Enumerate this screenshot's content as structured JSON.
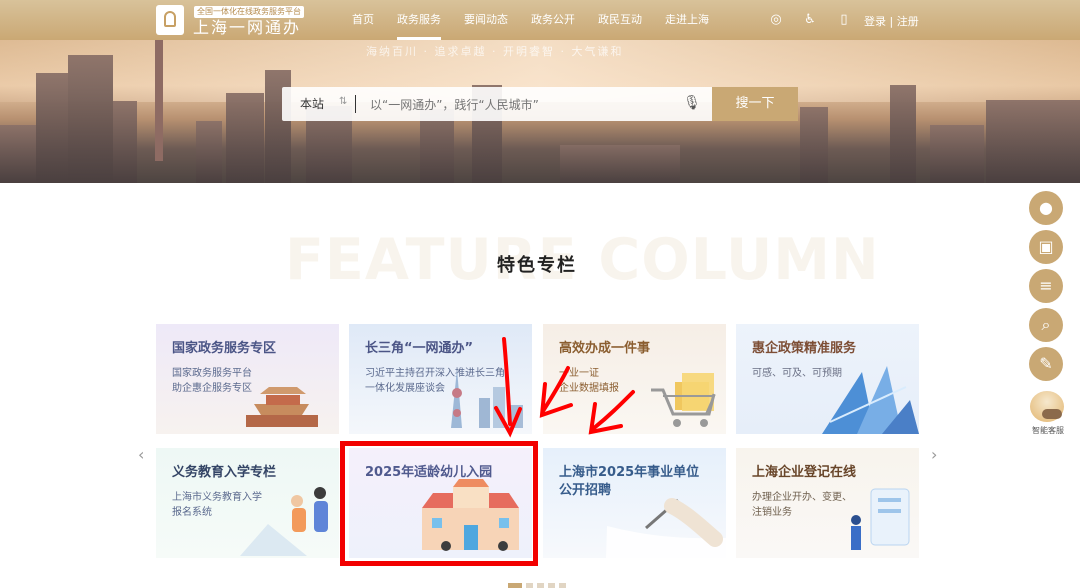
{
  "header": {
    "logo_small": "全国一体化在线政务服务平台",
    "logo_big": "上海一网通办",
    "nav": [
      "首页",
      "政务服务",
      "要闻动态",
      "政务公开",
      "政民互动",
      "走进上海"
    ],
    "active_nav": "政务服务",
    "tools": {
      "globe_icon": "globe",
      "accessibility_icon": "accessibility",
      "mobile_icon": "mobile"
    },
    "auth": {
      "login": "登录",
      "separator": "|",
      "register": "注册"
    }
  },
  "banner": {
    "slogan": "海纳百川 · 追求卓越 · 开明睿智 · 大气谦和"
  },
  "search": {
    "scope": "本站",
    "placeholder": "以“一网通办”，践行“人民城市”",
    "button": "搜一下"
  },
  "feature": {
    "bg_text": "FEATURE COLUMN",
    "title": "特色专栏"
  },
  "cards": [
    {
      "title": "国家政务服务专区",
      "lines": [
        "国家政务服务平台",
        "助企惠企服务专区"
      ]
    },
    {
      "title": "长三角“一网通办”",
      "lines": [
        "习近平主持召开深入推进长三角",
        "一体化发展座谈会"
      ]
    },
    {
      "title": "高效办成一件事",
      "lines": [
        "一业一证",
        "企业数据填报"
      ]
    },
    {
      "title": "惠企政策精准服务",
      "lines": [
        "可感、可及、可预期"
      ]
    },
    {
      "title": "义务教育入学专栏",
      "lines": [
        "上海市义务教育入学",
        "报名系统"
      ]
    },
    {
      "title": "2025年适龄幼儿入园",
      "lines": []
    },
    {
      "title": "上海市2025年事业单位公开招聘",
      "title_lines": [
        "上海市2025年事业单位",
        "公开招聘"
      ],
      "lines": []
    },
    {
      "title": "上海企业登记在线",
      "lines": [
        "办理企业开办、变更、",
        "注销业务"
      ]
    }
  ],
  "side": {
    "icons": [
      "user-icon",
      "calendar-icon",
      "document-icon",
      "search-icon",
      "pen-icon"
    ],
    "robot_label": "智能客服"
  },
  "colors": {
    "gold": "#c9a874",
    "red_highlight": "#f20000"
  }
}
